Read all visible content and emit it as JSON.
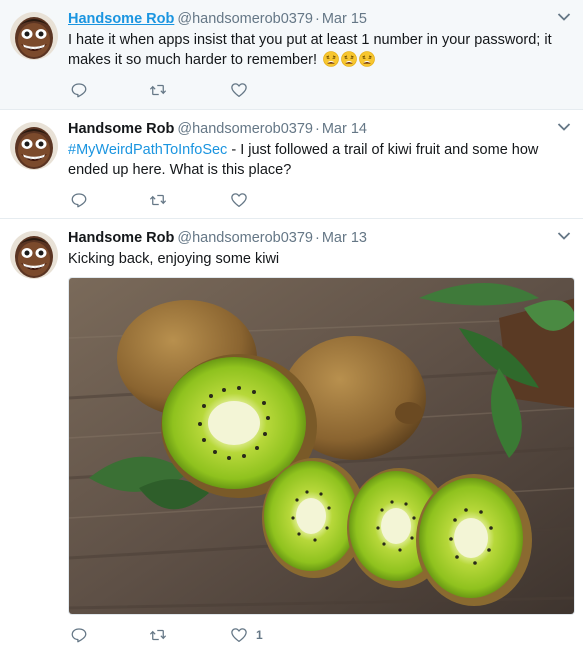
{
  "tweets": [
    {
      "name": "Handsome Rob",
      "handle": "@handsomerob0379",
      "separator": "·",
      "date": "Mar 15",
      "text": "I hate it when apps insist that you put at least 1 number in your password; it makes it so much harder to remember!",
      "emoji": [
        "weary-face",
        "weary-face",
        "weary-face"
      ],
      "likes": ""
    },
    {
      "name": "Handsome Rob",
      "handle": "@handsomerob0379",
      "separator": "·",
      "date": "Mar 14",
      "hashtag": "#MyWeirdPathToInfoSec",
      "text": " - I just followed a trail of kiwi fruit and some how ended up here. What is this place?",
      "likes": ""
    },
    {
      "name": "Handsome Rob",
      "handle": "@handsomerob0379",
      "separator": "·",
      "date": "Mar 13",
      "text": "Kicking back, enjoying some kiwi",
      "media": "kiwi-fruit-photo",
      "likes": "1"
    }
  ],
  "icons": {
    "reply": "reply-icon",
    "retweet": "retweet-icon",
    "like": "heart-icon",
    "more": "chevron-down-icon"
  },
  "colors": {
    "link": "#1b95e0",
    "muted": "#657786",
    "highlight_bg": "#f5f8fa",
    "divider": "#e6ecf0"
  }
}
